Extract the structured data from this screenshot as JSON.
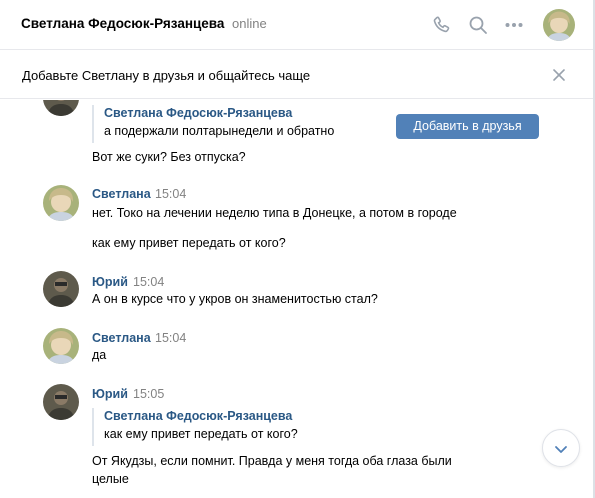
{
  "header": {
    "name": "Светлана Федосюк-Рязанцева",
    "status": "online"
  },
  "banner": {
    "text": "Добавьте Светлану в друзья и общайтесь чаще",
    "button_label": "Добавить в друзья"
  },
  "messages": [
    {
      "quote_author": "Светлана Федосюк-Рязанцева",
      "quote_text": "а подержали полтарынедели и обратно",
      "lines": [
        "Вот же суки? Без отпуска?"
      ]
    },
    {
      "author": "Светлана",
      "time": "15:04",
      "lines": [
        "нет. Токо на лечении неделю типа в Донецке, а потом в городе",
        "как ему привет передать от кого?"
      ]
    },
    {
      "author": "Юрий",
      "time": "15:04",
      "lines": [
        "А он в курсе что у укров он знаменитостью стал?"
      ]
    },
    {
      "author": "Светлана",
      "time": "15:04",
      "lines": [
        "да"
      ]
    },
    {
      "author": "Юрий",
      "time": "15:05",
      "quote_author": "Светлана Федосюк-Рязанцева",
      "quote_text": "как ему привет передать от кого?",
      "lines": [
        "От Якудзы, если помнит. Правда у меня тогда оба глаза были",
        "целые"
      ]
    }
  ],
  "colors": {
    "accent": "#5181b8",
    "link": "#2a5885",
    "muted": "#828282",
    "icon": "#99a2ad"
  },
  "icons": [
    "phone-icon",
    "search-icon",
    "more-icon",
    "close-icon",
    "chevron-down-icon"
  ]
}
